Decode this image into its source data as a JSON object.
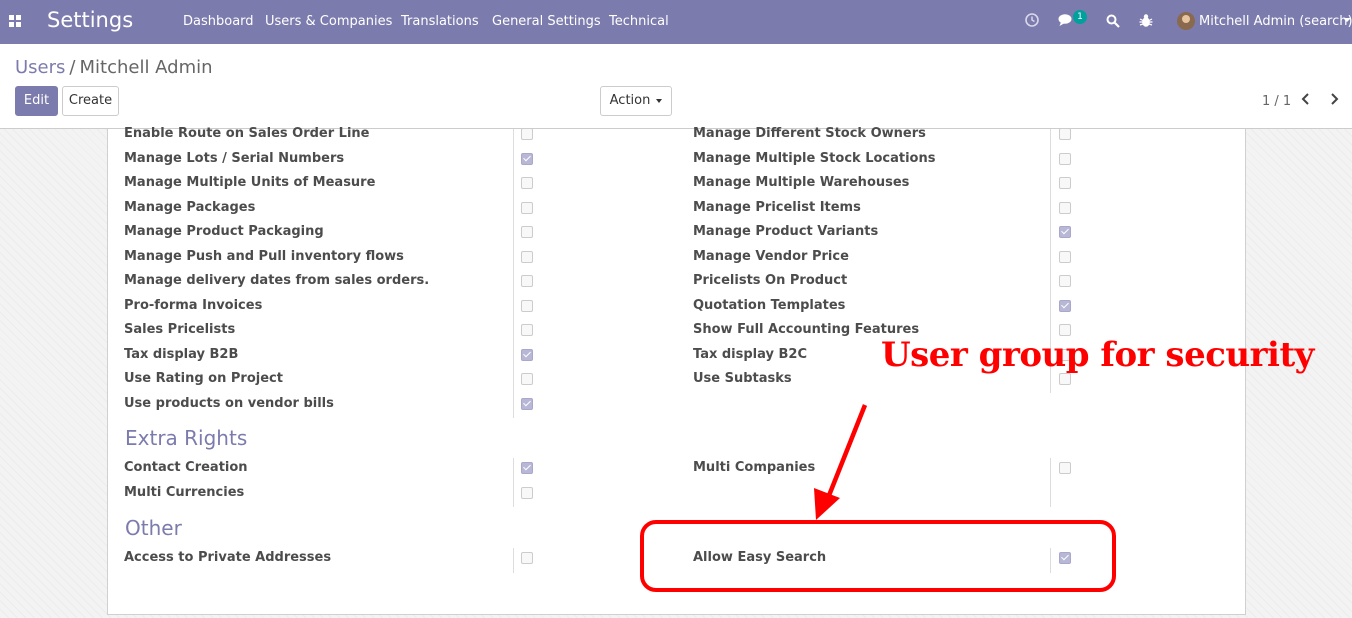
{
  "navbar": {
    "brand": "Settings",
    "menu": [
      "Dashboard",
      "Users & Companies",
      "Translations",
      "General Settings",
      "Technical"
    ],
    "messages_count": "1",
    "user": "Mitchell Admin (search)",
    "accent_color": "#7c7bad"
  },
  "breadcrumb": {
    "parent": "Users",
    "separator": "/",
    "current": "Mitchell Admin"
  },
  "toolbar": {
    "edit_label": "Edit",
    "create_label": "Create",
    "action_label": "Action"
  },
  "pager": {
    "value": "1 / 1"
  },
  "fields": {
    "left": [
      {
        "label": "Enable Route on Sales Order Line",
        "checked": false
      },
      {
        "label": "Manage Lots / Serial Numbers",
        "checked": true
      },
      {
        "label": "Manage Multiple Units of Measure",
        "checked": false
      },
      {
        "label": "Manage Packages",
        "checked": false
      },
      {
        "label": "Manage Product Packaging",
        "checked": false
      },
      {
        "label": "Manage Push and Pull inventory flows",
        "checked": false
      },
      {
        "label": "Manage delivery dates from sales orders.",
        "checked": false
      },
      {
        "label": "Pro-forma Invoices",
        "checked": false
      },
      {
        "label": "Sales Pricelists",
        "checked": false
      },
      {
        "label": "Tax display B2B",
        "checked": true
      },
      {
        "label": "Use Rating on Project",
        "checked": false
      },
      {
        "label": "Use products on vendor bills",
        "checked": true
      }
    ],
    "right": [
      {
        "label": "Manage Different Stock Owners",
        "checked": false
      },
      {
        "label": "Manage Multiple Stock Locations",
        "checked": false
      },
      {
        "label": "Manage Multiple Warehouses",
        "checked": false
      },
      {
        "label": "Manage Pricelist Items",
        "checked": false
      },
      {
        "label": "Manage Product Variants",
        "checked": true
      },
      {
        "label": "Manage Vendor Price",
        "checked": false
      },
      {
        "label": "Pricelists On Product",
        "checked": false
      },
      {
        "label": "Quotation Templates",
        "checked": true
      },
      {
        "label": "Show Full Accounting Features",
        "checked": false
      },
      {
        "label": "Tax display B2C",
        "checked": false
      },
      {
        "label": "Use Subtasks",
        "checked": false
      }
    ]
  },
  "extra_rights": {
    "title": "Extra Rights",
    "left": [
      {
        "label": "Contact Creation",
        "checked": true
      },
      {
        "label": "Multi Currencies",
        "checked": false
      }
    ],
    "right": [
      {
        "label": "Multi Companies",
        "checked": false
      }
    ]
  },
  "other": {
    "title": "Other",
    "left": [
      {
        "label": "Access to Private Addresses",
        "checked": false
      }
    ],
    "right": [
      {
        "label": "Allow Easy Search",
        "checked": true
      }
    ]
  },
  "annotation": {
    "text": "User group for security",
    "color": "#ff0000"
  }
}
